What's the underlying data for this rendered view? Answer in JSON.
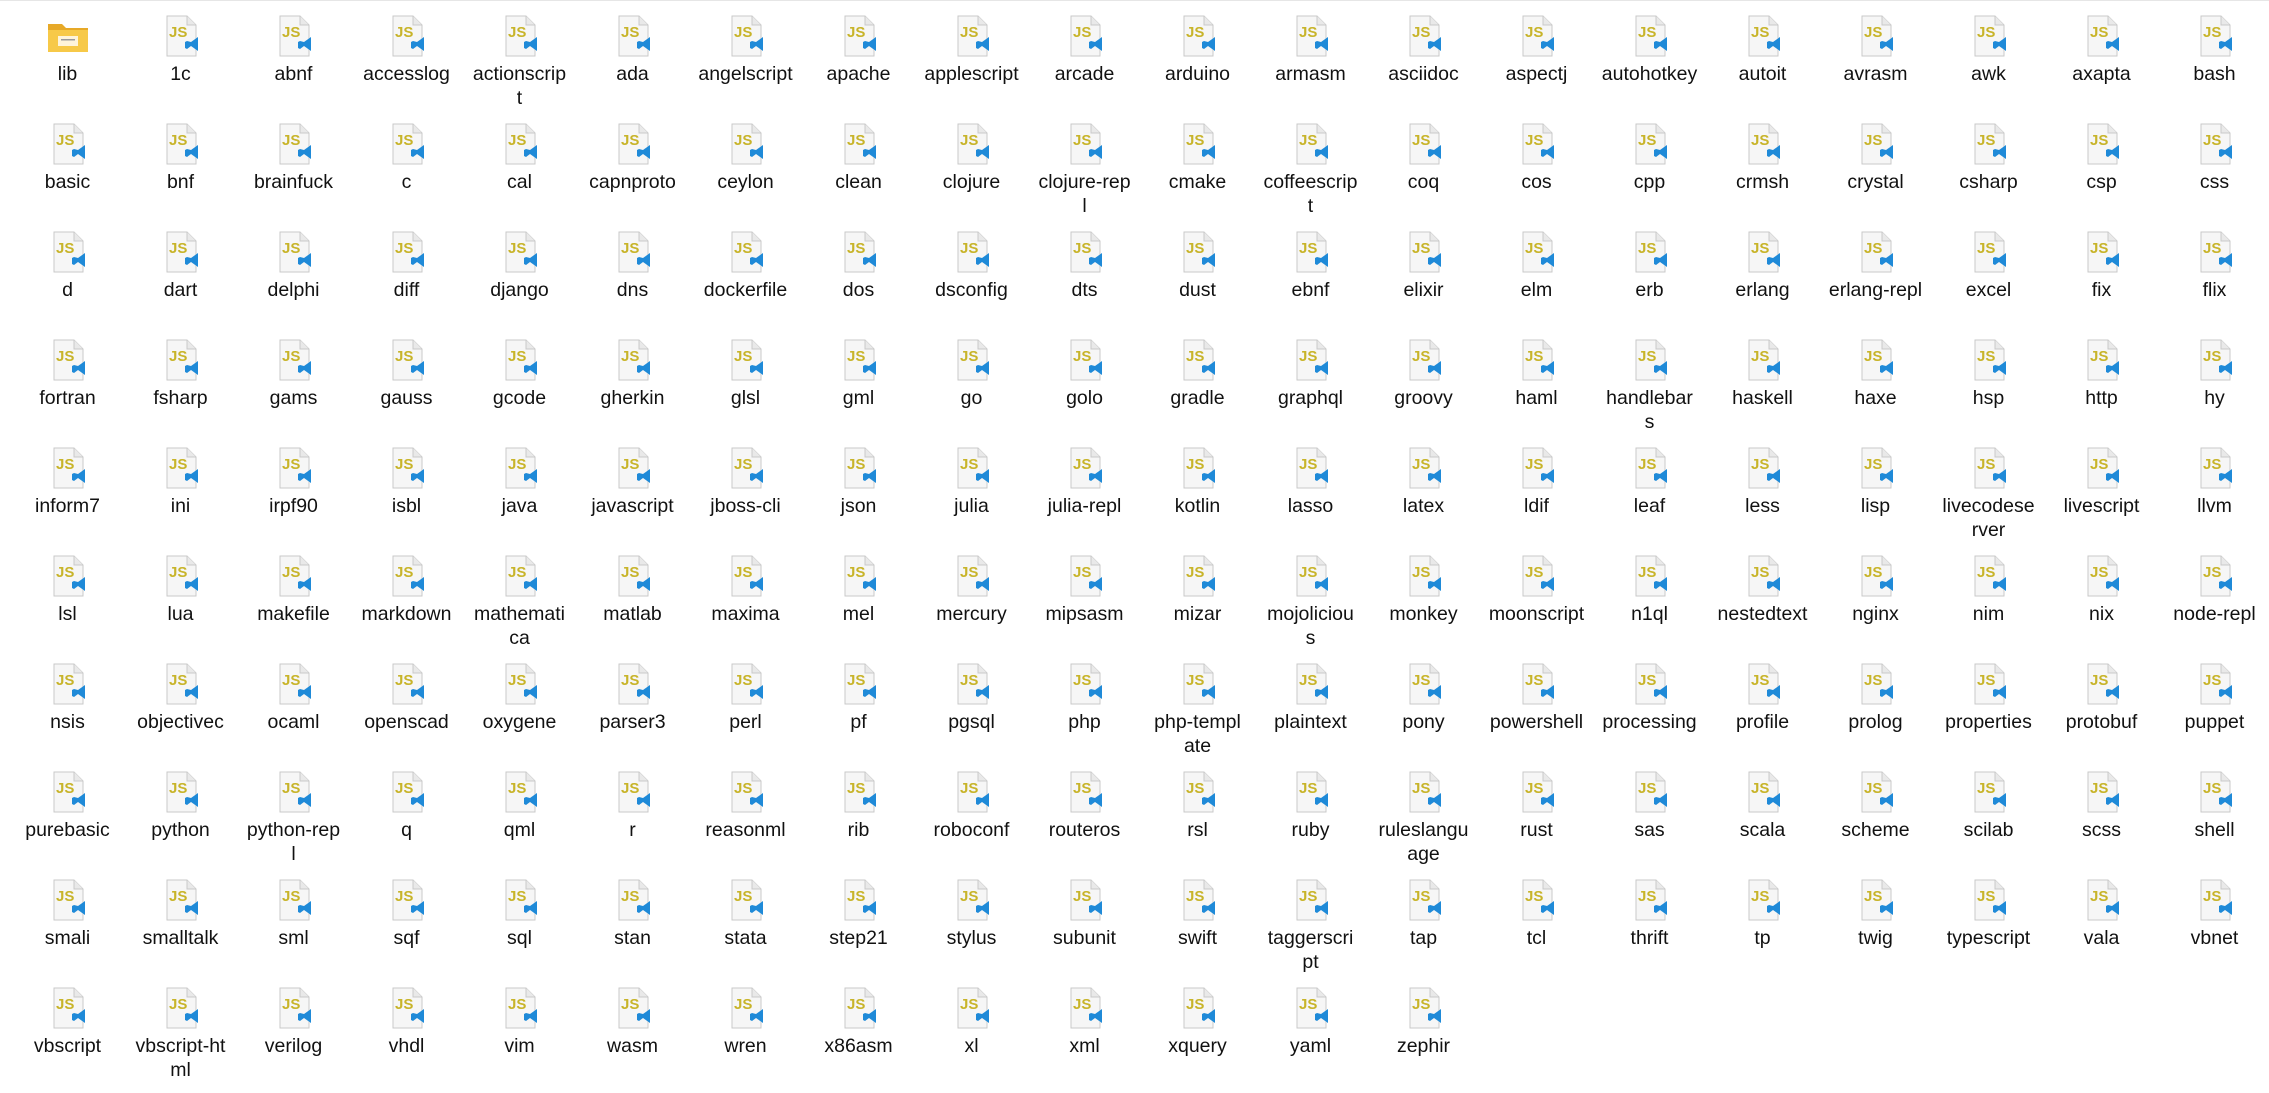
{
  "colors": {
    "js_letter": "#c8b42a",
    "page_fill": "#f6f6f6",
    "page_edge": "#c9c9c9",
    "vs_blue": "#1f8ad8",
    "folder_yellow": "#f7c948",
    "folder_dark": "#e7a928"
  },
  "items": [
    {
      "name": "lib",
      "type": "folder"
    },
    {
      "name": "1c",
      "type": "js"
    },
    {
      "name": "abnf",
      "type": "js"
    },
    {
      "name": "accesslog",
      "type": "js"
    },
    {
      "name": "actionscript",
      "type": "js"
    },
    {
      "name": "ada",
      "type": "js"
    },
    {
      "name": "angelscript",
      "type": "js"
    },
    {
      "name": "apache",
      "type": "js"
    },
    {
      "name": "applescript",
      "type": "js"
    },
    {
      "name": "arcade",
      "type": "js"
    },
    {
      "name": "arduino",
      "type": "js"
    },
    {
      "name": "armasm",
      "type": "js"
    },
    {
      "name": "asciidoc",
      "type": "js"
    },
    {
      "name": "aspectj",
      "type": "js"
    },
    {
      "name": "autohotkey",
      "type": "js"
    },
    {
      "name": "autoit",
      "type": "js"
    },
    {
      "name": "avrasm",
      "type": "js"
    },
    {
      "name": "awk",
      "type": "js"
    },
    {
      "name": "axapta",
      "type": "js"
    },
    {
      "name": "bash",
      "type": "js"
    },
    {
      "name": "basic",
      "type": "js"
    },
    {
      "name": "bnf",
      "type": "js"
    },
    {
      "name": "brainfuck",
      "type": "js"
    },
    {
      "name": "c",
      "type": "js"
    },
    {
      "name": "cal",
      "type": "js"
    },
    {
      "name": "capnproto",
      "type": "js"
    },
    {
      "name": "ceylon",
      "type": "js"
    },
    {
      "name": "clean",
      "type": "js"
    },
    {
      "name": "clojure",
      "type": "js"
    },
    {
      "name": "clojure-repl",
      "type": "js"
    },
    {
      "name": "cmake",
      "type": "js"
    },
    {
      "name": "coffeescript",
      "type": "js"
    },
    {
      "name": "coq",
      "type": "js"
    },
    {
      "name": "cos",
      "type": "js"
    },
    {
      "name": "cpp",
      "type": "js"
    },
    {
      "name": "crmsh",
      "type": "js"
    },
    {
      "name": "crystal",
      "type": "js"
    },
    {
      "name": "csharp",
      "type": "js"
    },
    {
      "name": "csp",
      "type": "js"
    },
    {
      "name": "css",
      "type": "js"
    },
    {
      "name": "d",
      "type": "js"
    },
    {
      "name": "dart",
      "type": "js"
    },
    {
      "name": "delphi",
      "type": "js"
    },
    {
      "name": "diff",
      "type": "js"
    },
    {
      "name": "django",
      "type": "js"
    },
    {
      "name": "dns",
      "type": "js"
    },
    {
      "name": "dockerfile",
      "type": "js"
    },
    {
      "name": "dos",
      "type": "js"
    },
    {
      "name": "dsconfig",
      "type": "js"
    },
    {
      "name": "dts",
      "type": "js"
    },
    {
      "name": "dust",
      "type": "js"
    },
    {
      "name": "ebnf",
      "type": "js"
    },
    {
      "name": "elixir",
      "type": "js"
    },
    {
      "name": "elm",
      "type": "js"
    },
    {
      "name": "erb",
      "type": "js"
    },
    {
      "name": "erlang",
      "type": "js"
    },
    {
      "name": "erlang-repl",
      "type": "js"
    },
    {
      "name": "excel",
      "type": "js"
    },
    {
      "name": "fix",
      "type": "js"
    },
    {
      "name": "flix",
      "type": "js"
    },
    {
      "name": "fortran",
      "type": "js"
    },
    {
      "name": "fsharp",
      "type": "js"
    },
    {
      "name": "gams",
      "type": "js"
    },
    {
      "name": "gauss",
      "type": "js"
    },
    {
      "name": "gcode",
      "type": "js"
    },
    {
      "name": "gherkin",
      "type": "js"
    },
    {
      "name": "glsl",
      "type": "js"
    },
    {
      "name": "gml",
      "type": "js"
    },
    {
      "name": "go",
      "type": "js"
    },
    {
      "name": "golo",
      "type": "js"
    },
    {
      "name": "gradle",
      "type": "js"
    },
    {
      "name": "graphql",
      "type": "js"
    },
    {
      "name": "groovy",
      "type": "js"
    },
    {
      "name": "haml",
      "type": "js"
    },
    {
      "name": "handlebars",
      "type": "js"
    },
    {
      "name": "haskell",
      "type": "js"
    },
    {
      "name": "haxe",
      "type": "js"
    },
    {
      "name": "hsp",
      "type": "js"
    },
    {
      "name": "http",
      "type": "js"
    },
    {
      "name": "hy",
      "type": "js"
    },
    {
      "name": "inform7",
      "type": "js"
    },
    {
      "name": "ini",
      "type": "js"
    },
    {
      "name": "irpf90",
      "type": "js"
    },
    {
      "name": "isbl",
      "type": "js"
    },
    {
      "name": "java",
      "type": "js"
    },
    {
      "name": "javascript",
      "type": "js"
    },
    {
      "name": "jboss-cli",
      "type": "js"
    },
    {
      "name": "json",
      "type": "js"
    },
    {
      "name": "julia",
      "type": "js"
    },
    {
      "name": "julia-repl",
      "type": "js"
    },
    {
      "name": "kotlin",
      "type": "js"
    },
    {
      "name": "lasso",
      "type": "js"
    },
    {
      "name": "latex",
      "type": "js"
    },
    {
      "name": "ldif",
      "type": "js"
    },
    {
      "name": "leaf",
      "type": "js"
    },
    {
      "name": "less",
      "type": "js"
    },
    {
      "name": "lisp",
      "type": "js"
    },
    {
      "name": "livecodeserver",
      "type": "js"
    },
    {
      "name": "livescript",
      "type": "js"
    },
    {
      "name": "llvm",
      "type": "js"
    },
    {
      "name": "lsl",
      "type": "js"
    },
    {
      "name": "lua",
      "type": "js"
    },
    {
      "name": "makefile",
      "type": "js"
    },
    {
      "name": "markdown",
      "type": "js"
    },
    {
      "name": "mathematica",
      "type": "js"
    },
    {
      "name": "matlab",
      "type": "js"
    },
    {
      "name": "maxima",
      "type": "js"
    },
    {
      "name": "mel",
      "type": "js"
    },
    {
      "name": "mercury",
      "type": "js"
    },
    {
      "name": "mipsasm",
      "type": "js"
    },
    {
      "name": "mizar",
      "type": "js"
    },
    {
      "name": "mojolicious",
      "type": "js"
    },
    {
      "name": "monkey",
      "type": "js"
    },
    {
      "name": "moonscript",
      "type": "js"
    },
    {
      "name": "n1ql",
      "type": "js"
    },
    {
      "name": "nestedtext",
      "type": "js"
    },
    {
      "name": "nginx",
      "type": "js"
    },
    {
      "name": "nim",
      "type": "js"
    },
    {
      "name": "nix",
      "type": "js"
    },
    {
      "name": "node-repl",
      "type": "js"
    },
    {
      "name": "nsis",
      "type": "js"
    },
    {
      "name": "objectivec",
      "type": "js"
    },
    {
      "name": "ocaml",
      "type": "js"
    },
    {
      "name": "openscad",
      "type": "js"
    },
    {
      "name": "oxygene",
      "type": "js"
    },
    {
      "name": "parser3",
      "type": "js"
    },
    {
      "name": "perl",
      "type": "js"
    },
    {
      "name": "pf",
      "type": "js"
    },
    {
      "name": "pgsql",
      "type": "js"
    },
    {
      "name": "php",
      "type": "js"
    },
    {
      "name": "php-template",
      "type": "js"
    },
    {
      "name": "plaintext",
      "type": "js"
    },
    {
      "name": "pony",
      "type": "js"
    },
    {
      "name": "powershell",
      "type": "js"
    },
    {
      "name": "processing",
      "type": "js"
    },
    {
      "name": "profile",
      "type": "js"
    },
    {
      "name": "prolog",
      "type": "js"
    },
    {
      "name": "properties",
      "type": "js"
    },
    {
      "name": "protobuf",
      "type": "js"
    },
    {
      "name": "puppet",
      "type": "js"
    },
    {
      "name": "purebasic",
      "type": "js"
    },
    {
      "name": "python",
      "type": "js"
    },
    {
      "name": "python-repl",
      "type": "js"
    },
    {
      "name": "q",
      "type": "js"
    },
    {
      "name": "qml",
      "type": "js"
    },
    {
      "name": "r",
      "type": "js"
    },
    {
      "name": "reasonml",
      "type": "js"
    },
    {
      "name": "rib",
      "type": "js"
    },
    {
      "name": "roboconf",
      "type": "js"
    },
    {
      "name": "routeros",
      "type": "js"
    },
    {
      "name": "rsl",
      "type": "js"
    },
    {
      "name": "ruby",
      "type": "js"
    },
    {
      "name": "ruleslanguage",
      "type": "js"
    },
    {
      "name": "rust",
      "type": "js"
    },
    {
      "name": "sas",
      "type": "js"
    },
    {
      "name": "scala",
      "type": "js"
    },
    {
      "name": "scheme",
      "type": "js"
    },
    {
      "name": "scilab",
      "type": "js"
    },
    {
      "name": "scss",
      "type": "js"
    },
    {
      "name": "shell",
      "type": "js"
    },
    {
      "name": "smali",
      "type": "js"
    },
    {
      "name": "smalltalk",
      "type": "js"
    },
    {
      "name": "sml",
      "type": "js"
    },
    {
      "name": "sqf",
      "type": "js"
    },
    {
      "name": "sql",
      "type": "js"
    },
    {
      "name": "stan",
      "type": "js"
    },
    {
      "name": "stata",
      "type": "js"
    },
    {
      "name": "step21",
      "type": "js"
    },
    {
      "name": "stylus",
      "type": "js"
    },
    {
      "name": "subunit",
      "type": "js"
    },
    {
      "name": "swift",
      "type": "js"
    },
    {
      "name": "taggerscript",
      "type": "js"
    },
    {
      "name": "tap",
      "type": "js"
    },
    {
      "name": "tcl",
      "type": "js"
    },
    {
      "name": "thrift",
      "type": "js"
    },
    {
      "name": "tp",
      "type": "js"
    },
    {
      "name": "twig",
      "type": "js"
    },
    {
      "name": "typescript",
      "type": "js"
    },
    {
      "name": "vala",
      "type": "js"
    },
    {
      "name": "vbnet",
      "type": "js"
    },
    {
      "name": "vbscript",
      "type": "js"
    },
    {
      "name": "vbscript-html",
      "type": "js"
    },
    {
      "name": "verilog",
      "type": "js"
    },
    {
      "name": "vhdl",
      "type": "js"
    },
    {
      "name": "vim",
      "type": "js"
    },
    {
      "name": "wasm",
      "type": "js"
    },
    {
      "name": "wren",
      "type": "js"
    },
    {
      "name": "x86asm",
      "type": "js"
    },
    {
      "name": "xl",
      "type": "js"
    },
    {
      "name": "xml",
      "type": "js"
    },
    {
      "name": "xquery",
      "type": "js"
    },
    {
      "name": "yaml",
      "type": "js"
    },
    {
      "name": "zephir",
      "type": "js"
    }
  ],
  "icon_text": {
    "js": "JS"
  }
}
